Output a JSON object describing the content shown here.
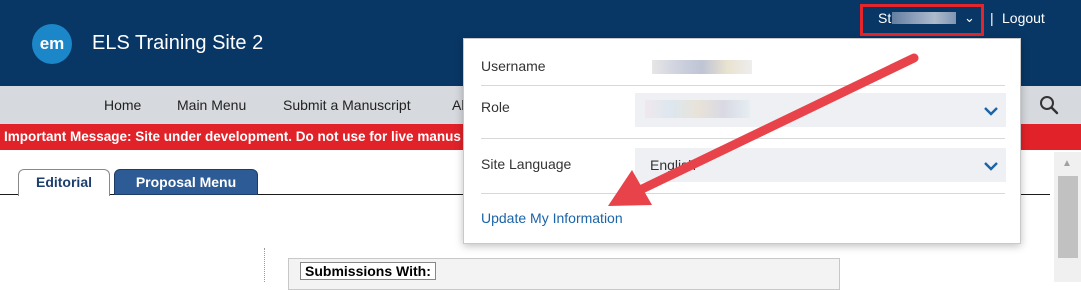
{
  "header": {
    "logo_text": "em",
    "site_title": "ELS Training Site 2",
    "user_initials": "St",
    "separator": "|",
    "logout_label": "Logout"
  },
  "nav": {
    "items": [
      "Home",
      "Main Menu",
      "Submit a Manuscript",
      "Ab"
    ],
    "search_icon": "search-icon"
  },
  "alert": {
    "text": "Important Message: Site under development. Do not use for live manus"
  },
  "tabs": [
    {
      "label": "Editorial",
      "active": true
    },
    {
      "label": "Proposal Menu",
      "active": false
    }
  ],
  "content": {
    "submissions_label": "Submissions With:"
  },
  "user_menu": {
    "username_label": "Username",
    "role_label": "Role",
    "language_label": "Site Language",
    "language_value": "English",
    "update_link": "Update My Information"
  },
  "colors": {
    "header_bg": "#083766",
    "nav_bg": "#d6d9dd",
    "alert_bg": "#e12228",
    "highlight": "#e4262c",
    "link": "#1a64a8"
  }
}
